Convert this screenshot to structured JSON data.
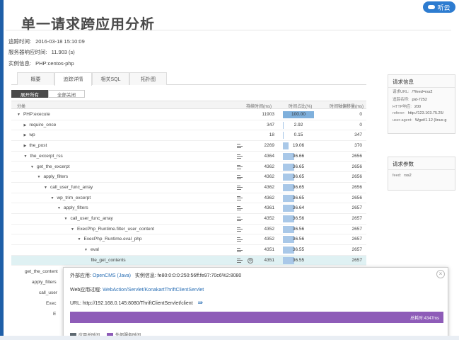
{
  "logo": {
    "text": "听云"
  },
  "page": {
    "title": "单一请求跨应用分析"
  },
  "meta": [
    {
      "label": "追踪时间:",
      "value": "2016-03-18 15:10:09"
    },
    {
      "label": "服务器响应时间:",
      "value": "11.903 (s)"
    },
    {
      "label": "实例信息:",
      "value": "PHP:centos-php"
    }
  ],
  "tabs": [
    {
      "label": "概要",
      "active": false
    },
    {
      "label": "追踪详情",
      "active": true
    },
    {
      "label": "相关SQL",
      "active": false
    },
    {
      "label": "拓扑图",
      "active": false
    }
  ],
  "buttons": {
    "expand_all": "展开所有",
    "collapse_all": "全部关闭"
  },
  "table": {
    "headers": {
      "method": "分类",
      "duration": "持续时间(ms)",
      "pct": "时间占比(%)",
      "outer": "时间轴偏移量(ms)"
    },
    "rows": [
      {
        "name": "PHP:execute",
        "depth": 0,
        "open": true,
        "ms": "11903",
        "pct": "100.00",
        "pct_value": 100,
        "outer": "0",
        "icons": false
      },
      {
        "name": "require_once",
        "depth": 1,
        "open": false,
        "ms": "347",
        "pct": "2.92",
        "pct_value": 2.92,
        "outer": "0",
        "icons": false
      },
      {
        "name": "wp",
        "depth": 1,
        "open": false,
        "ms": "18",
        "pct": "0.15",
        "pct_value": 0.15,
        "outer": "347",
        "icons": false
      },
      {
        "name": "the_post",
        "depth": 1,
        "open": false,
        "ms": "2269",
        "pct": "19.06",
        "pct_value": 19.06,
        "outer": "370",
        "icons": true
      },
      {
        "name": "the_excerpt_rss",
        "depth": 1,
        "open": true,
        "ms": "4364",
        "pct": "36.66",
        "pct_value": 36.66,
        "outer": "2656",
        "icons": true
      },
      {
        "name": "get_the_excerpt",
        "depth": 2,
        "open": true,
        "ms": "4362",
        "pct": "36.65",
        "pct_value": 36.65,
        "outer": "2656",
        "icons": true
      },
      {
        "name": "apply_filters",
        "depth": 3,
        "open": true,
        "ms": "4362",
        "pct": "36.65",
        "pct_value": 36.65,
        "outer": "2656",
        "icons": true
      },
      {
        "name": "call_user_func_array",
        "depth": 4,
        "open": true,
        "ms": "4362",
        "pct": "36.65",
        "pct_value": 36.65,
        "outer": "2656",
        "icons": true
      },
      {
        "name": "wp_trim_excerpt",
        "depth": 5,
        "open": true,
        "ms": "4362",
        "pct": "36.65",
        "pct_value": 36.65,
        "outer": "2656",
        "icons": true
      },
      {
        "name": "apply_filters",
        "depth": 6,
        "open": true,
        "ms": "4361",
        "pct": "36.64",
        "pct_value": 36.64,
        "outer": "2657",
        "icons": true
      },
      {
        "name": "call_user_func_array",
        "depth": 7,
        "open": true,
        "ms": "4352",
        "pct": "36.56",
        "pct_value": 36.56,
        "outer": "2657",
        "icons": true
      },
      {
        "name": "ExecPhp_Runtime.filter_user_content",
        "depth": 8,
        "open": true,
        "ms": "4352",
        "pct": "36.56",
        "pct_value": 36.56,
        "outer": "2657",
        "icons": true
      },
      {
        "name": "ExecPhp_Runtime.eval_php",
        "depth": 9,
        "open": true,
        "ms": "4352",
        "pct": "36.56",
        "pct_value": 36.56,
        "outer": "2657",
        "icons": true
      },
      {
        "name": "eval",
        "depth": 10,
        "open": true,
        "ms": "4351",
        "pct": "36.55",
        "pct_value": 36.55,
        "outer": "2657",
        "icons": true
      },
      {
        "name": "file_get_contents",
        "depth": 11,
        "open": null,
        "ms": "4351",
        "pct": "36.55",
        "pct_value": 36.55,
        "outer": "2657",
        "icons": true,
        "gear": true,
        "highlight": true
      }
    ],
    "partial_rows": [
      "get_the_content",
      "apply_filters",
      "call_user",
      "Exec",
      "E"
    ]
  },
  "request_info": {
    "title": "请求信息",
    "lines": [
      {
        "k": "请求URL:",
        "v": "/?feed=rss2"
      },
      {
        "k": "追踪名称:",
        "v": "pid-7252"
      },
      {
        "k": "HTTP响应:",
        "v": "200"
      },
      {
        "k": "referer:",
        "v": "http://123.103.75.25/"
      },
      {
        "k": "user-agent:",
        "v": "Wget/1.12 (linux-g"
      }
    ]
  },
  "request_params": {
    "title": "请求参数",
    "lines": [
      {
        "k": "feed:",
        "v": "rss2"
      }
    ]
  },
  "popup": {
    "external_app_label": "外部应用:",
    "external_app": "OpenCMS (Java)",
    "instance_label": "实例信息:",
    "instance": "fe80:0:0:0:250:56ff:fe97:70c6%2:8080",
    "web_process_label": "Web应用过程:",
    "web_process": "WebAction/Servlet/KonakartThriftClientServlet",
    "url_label": "URL:",
    "url": "http://192.168.0.145:8080/ThriftClientServlet/client",
    "bar_label": "总耗时:4347ms",
    "legend_app": "应用总时间",
    "legend_ext": "外部服务时间"
  },
  "colors": {
    "accent": "#2d7cd0",
    "bar": "#a9c8e8",
    "external": "#8e5cb8",
    "highlight_row": "#dff1f3"
  }
}
